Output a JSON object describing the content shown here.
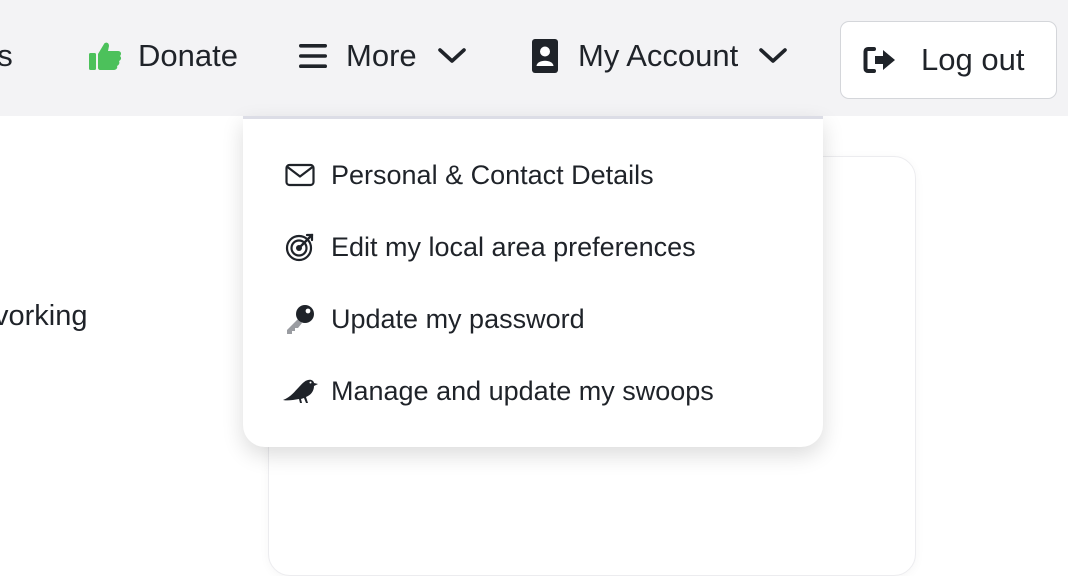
{
  "nav": {
    "partial_label": "es",
    "donate": {
      "label": "Donate",
      "icon": "thumbs-up-icon",
      "icon_color": "#4cc15b"
    },
    "more": {
      "label": "More",
      "icon": "hamburger-icon"
    },
    "account": {
      "label": "My Account",
      "icon": "contact-book-icon"
    },
    "logout": {
      "label": "Log out",
      "icon": "sign-out-icon"
    }
  },
  "account_menu": {
    "items": [
      {
        "label": "Personal & Contact Details",
        "icon": "envelope-icon"
      },
      {
        "label": "Edit my local area preferences",
        "icon": "radar-target-icon"
      },
      {
        "label": "Update my password",
        "icon": "key-icon"
      },
      {
        "label": "Manage and update my swoops",
        "icon": "bird-icon"
      }
    ]
  },
  "background": {
    "partial_text": "vorking"
  },
  "colors": {
    "topbar_bg": "#f3f3f5",
    "text": "#1f2329",
    "accent_green": "#4cc15b"
  }
}
